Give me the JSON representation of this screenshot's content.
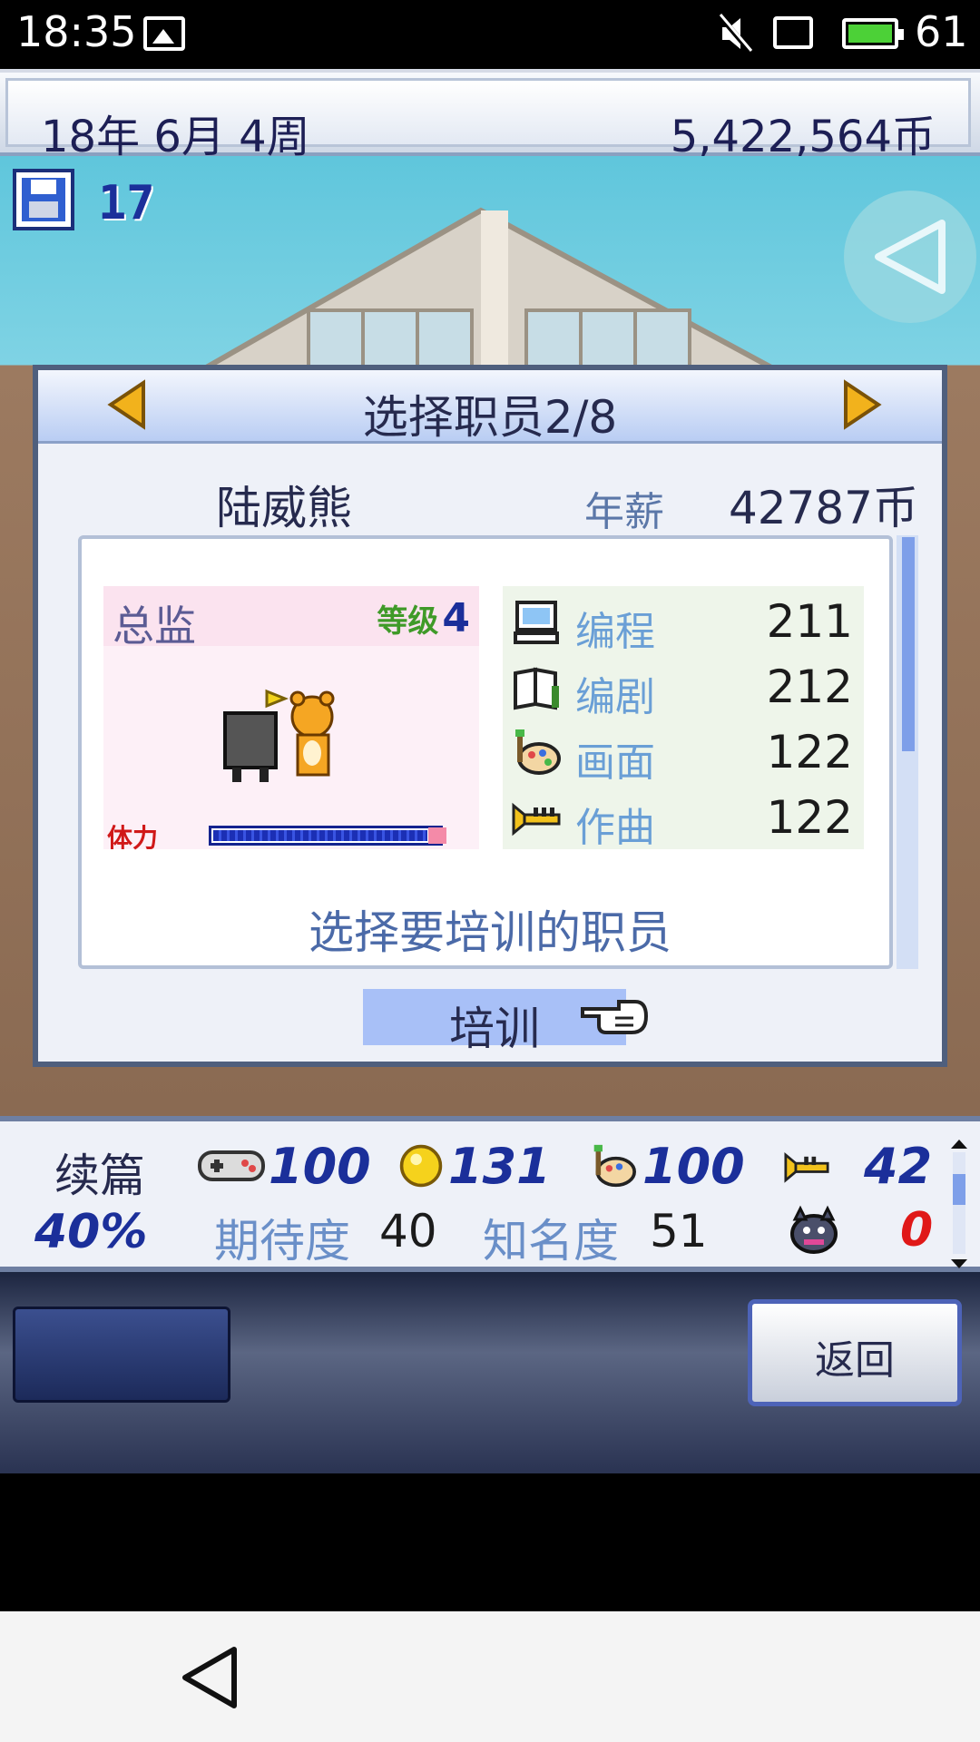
{
  "status_bar": {
    "time": "18:35",
    "battery_level": "61",
    "icons": [
      "image-icon",
      "mute-icon",
      "cast-icon",
      "battery-icon"
    ]
  },
  "top_bar": {
    "date": "18年 6月 4周",
    "money": "5,422,564币"
  },
  "scene": {
    "save_count": "17"
  },
  "dialog": {
    "title": "选择职员2/8",
    "employee": {
      "name": "陆威熊",
      "salary_label": "年薪",
      "salary": "42787币",
      "role": "总监",
      "level_label": "等级",
      "level": "4",
      "stamina_label": "体力",
      "stamina": 0.95
    },
    "skills": [
      {
        "icon": "computer-icon",
        "name": "编程",
        "value": "211"
      },
      {
        "icon": "book-icon",
        "name": "编剧",
        "value": "212"
      },
      {
        "icon": "palette-icon",
        "name": "画面",
        "value": "122"
      },
      {
        "icon": "trumpet-icon",
        "name": "作曲",
        "value": "122"
      }
    ],
    "prompt": "选择要培训的职员",
    "train_button": "培训"
  },
  "info_bar": {
    "sequel_label": "续篇",
    "sequel_pct": "40%",
    "stats": [
      {
        "icon": "gamepad-icon",
        "value": "100"
      },
      {
        "icon": "coin-icon",
        "value": "131"
      },
      {
        "icon": "palette-icon",
        "value": "100"
      },
      {
        "icon": "trumpet-icon",
        "value": "42"
      }
    ],
    "expect_label": "期待度",
    "expect_value": "40",
    "fame_label": "知名度",
    "fame_value": "51",
    "fans": "0"
  },
  "controls": {
    "back_button": "返回"
  },
  "colors": {
    "accent": "#1b2f9a",
    "panel_bg": "#eef1f8",
    "header": "#b9cdf3"
  }
}
